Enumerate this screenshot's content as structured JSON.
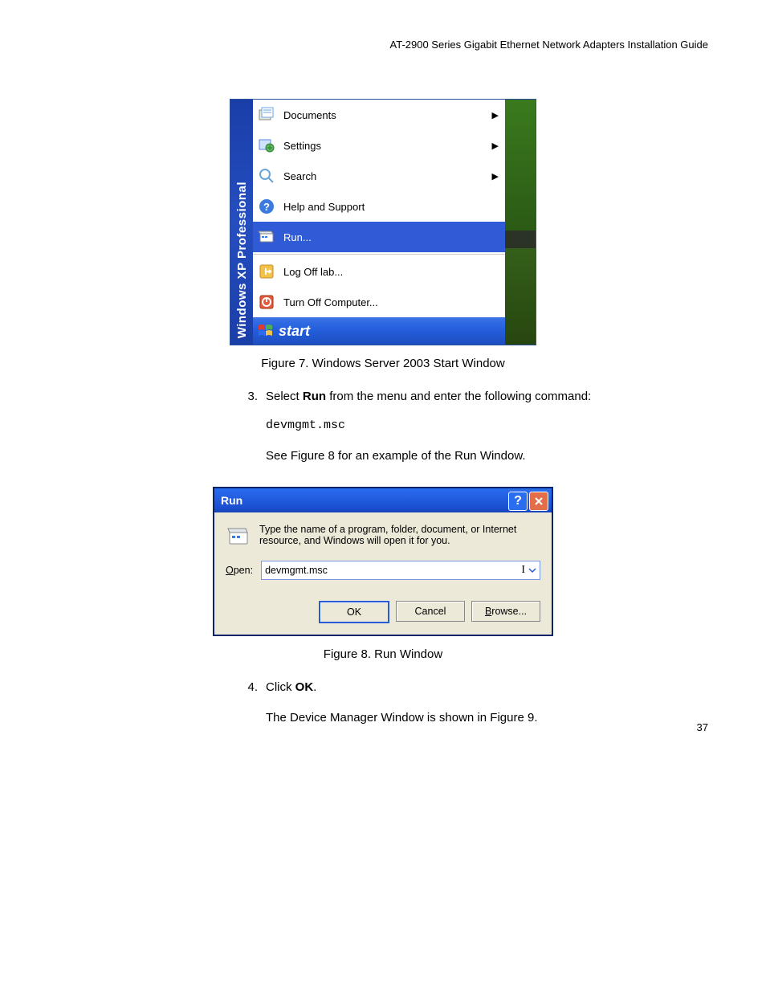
{
  "header": "AT-2900 Series Gigabit Ethernet Network Adapters Installation Guide",
  "startmenu": {
    "sideband": "Windows XP  Professional",
    "items": [
      {
        "icon": "documents",
        "label": "Documents",
        "submenu": true,
        "selected": false
      },
      {
        "icon": "settings",
        "label": "Settings",
        "submenu": true,
        "selected": false
      },
      {
        "icon": "search",
        "label": "Search",
        "submenu": true,
        "selected": false
      },
      {
        "icon": "help",
        "label": "Help and Support",
        "submenu": false,
        "selected": false
      },
      {
        "icon": "run",
        "label": "Run...",
        "submenu": false,
        "selected": true
      }
    ],
    "lower": [
      {
        "icon": "logoff",
        "label": "Log Off lab..."
      },
      {
        "icon": "turnoff",
        "label": "Turn Off Computer..."
      }
    ],
    "startbutton": "start"
  },
  "fig7": "Figure 7. Windows Server 2003 Start Window",
  "step3": {
    "num": "3.",
    "leadA": "Select ",
    "bold": "Run",
    "leadB": " from the menu and enter the following command:"
  },
  "cmd": "devmgmt.msc",
  "see8": "See Figure 8 for an example of the Run Window.",
  "rundlg": {
    "title": "Run",
    "desc": "Type the name of a program, folder, document, or Internet resource, and Windows will open it for you.",
    "openlabel_pre": "O",
    "openlabel_rest": "pen:",
    "value": "devmgmt.msc",
    "ok": "OK",
    "cancel": "Cancel",
    "browse_pre": "B",
    "browse_rest": "rowse..."
  },
  "fig8": "Figure 8. Run Window",
  "step4": {
    "num": "4.",
    "leadA": "Click ",
    "bold": "OK",
    "leadB": "."
  },
  "devmgr": "The Device Manager Window is shown in Figure 9.",
  "pagenum": "37"
}
